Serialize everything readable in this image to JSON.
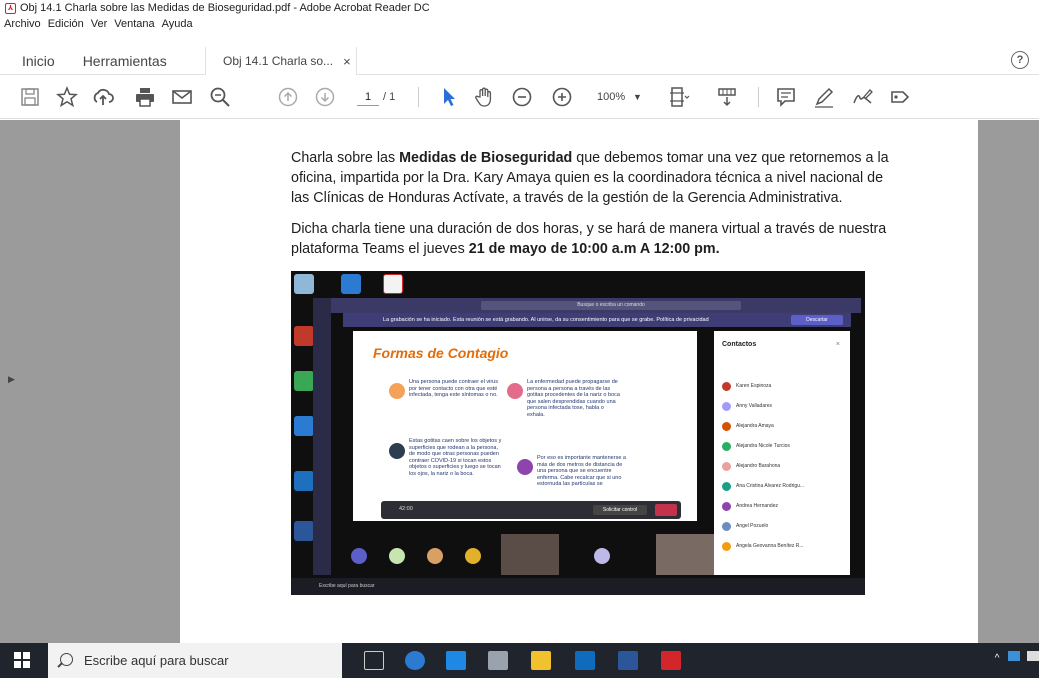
{
  "window": {
    "title": "Obj 14.1 Charla sobre las Medidas de Bioseguridad.pdf - Adobe Acrobat Reader DC"
  },
  "menu": [
    "Archivo",
    "Edición",
    "Ver",
    "Ventana",
    "Ayuda"
  ],
  "tabs": {
    "home": "Inicio",
    "tools": "Herramientas",
    "document": "Obj 14.1 Charla so...",
    "close": "×"
  },
  "help": "?",
  "toolbar": {
    "page_current": "1",
    "page_total": "/ 1",
    "zoom": "100%",
    "zoom_caret": "▼"
  },
  "document": {
    "p1_a": "Charla sobre las ",
    "p1_bold": "Medidas de Bioseguridad",
    "p1_b": " que debemos tomar una vez que retornemos a la oficina, impartida por la Dra. Kary Amaya quien es la coordinadora técnica a nivel nacional de las Clínicas de Honduras Actívate, a través de la gestión de la Gerencia Administrativa.",
    "p2_a": "Dicha charla tiene una duración de dos horas, y se hará de manera virtual a través de nuestra plataforma Teams el jueves ",
    "p2_bold": "21 de mayo de 10:00 a.m  A 12:00 pm."
  },
  "screenshot": {
    "search": "Busque o escriba un comando",
    "recording": "La grabación se ha iniciado. Esta reunión se está grabando. Al unirse, da su consentimiento para que se grabe. Política de privacidad",
    "dismiss": "Descartar",
    "slide_title": "Formas de Contagio",
    "slide_text_1": "Una persona puede contraer el virus por tener contacto con otra que esté infectada, tenga este síntomas o no.",
    "slide_text_2": "La enfermedad puede propagarse de persona a persona a través de las gotitas procedentes de la nariz o boca que salen desprendidas cuando una persona infectada tose, habla o exhala.",
    "slide_text_3": "Estas gotitas caen sobre los objetos y superficies que rodean a la persona, de modo que otras personas pueden contraer COVID-19 si tocan estos objetos o superficies y luego se tocan los ojos, la nariz o la boca.",
    "slide_text_4": "Por eso es importante mantenerse a más de dos metros de distancia de una persona que se encuentre enferma. Cabe recalcar que si uno estornuda las partículas se",
    "contacts_title": "Contactos",
    "contacts": [
      "Karen Espinoza",
      "Anny Valladares",
      "Alejandra Amaya",
      "Alejandra Nicole Turcios",
      "Alejandro Barahona",
      "Ana Cristina Alvarez Rodrigu...",
      "Andrea Hernandez",
      "Angel Pozuelo",
      "Angela Geovanna Benítez R..."
    ],
    "time": "42:00",
    "control": "Solicitar control",
    "inner_search": "Escribe aquí para buscar"
  },
  "taskbar": {
    "search_placeholder": "Escribe aquí para buscar"
  }
}
